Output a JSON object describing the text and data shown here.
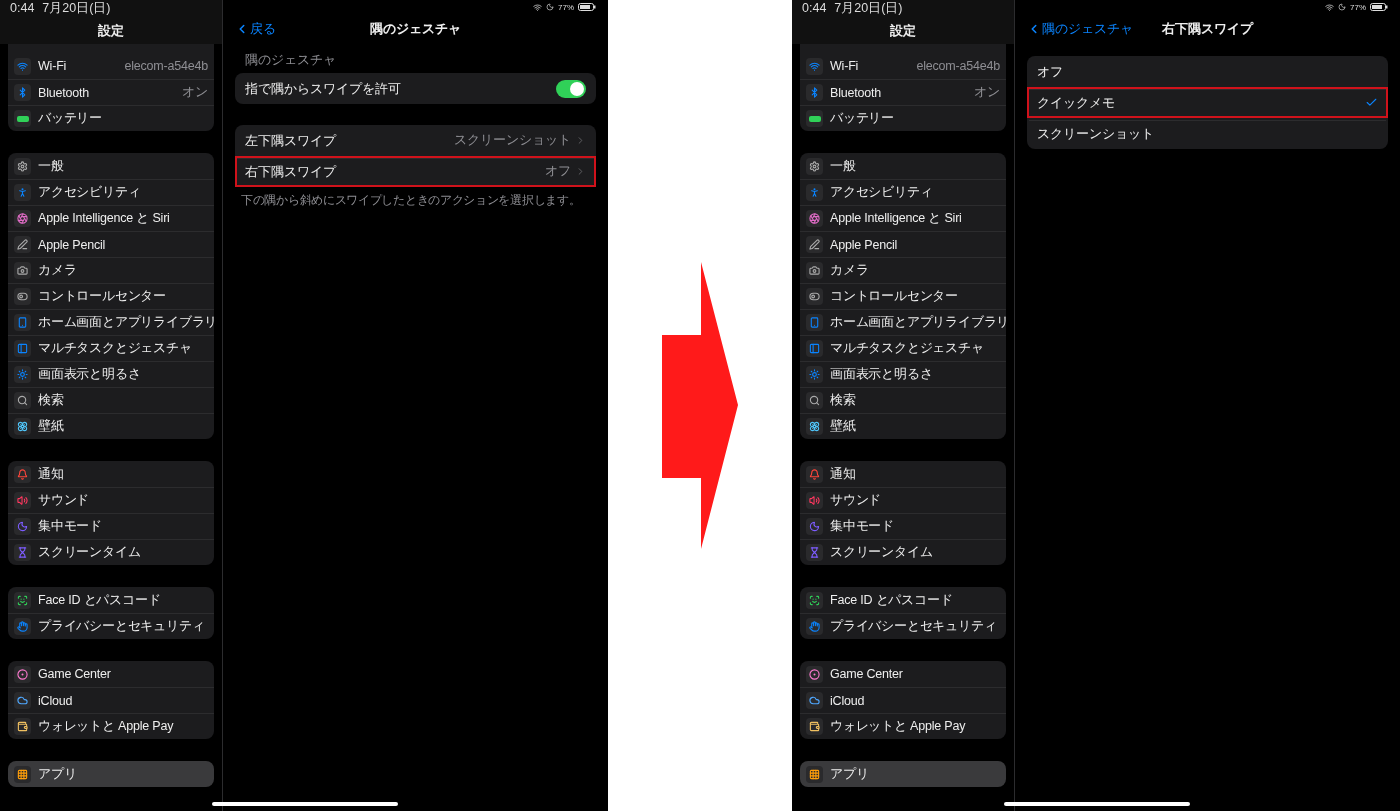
{
  "screens": [
    {
      "status": {
        "time": "0:44",
        "date": "7月20日(日)",
        "battery": "77%"
      },
      "sidebar": {
        "title": "設定",
        "groups": [
          {
            "items": [
              {
                "label": "Wi-Fi",
                "value": "elecom-a54e4b",
                "selected": false
              },
              {
                "label": "Bluetooth",
                "value": "オン",
                "selected": false
              },
              {
                "label": "バッテリー",
                "selected": false
              }
            ]
          },
          {
            "items": [
              {
                "label": "一般",
                "selected": false
              },
              {
                "label": "アクセシビリティ",
                "selected": false
              },
              {
                "label": "Apple Intelligence と Siri",
                "selected": false
              },
              {
                "label": "Apple Pencil",
                "selected": false
              },
              {
                "label": "カメラ",
                "selected": false
              },
              {
                "label": "コントロールセンター",
                "selected": false
              },
              {
                "label": "ホーム画面とアプリライブラリ",
                "selected": false
              },
              {
                "label": "マルチタスクとジェスチャ",
                "selected": false
              },
              {
                "label": "画面表示と明るさ",
                "selected": false
              },
              {
                "label": "検索",
                "selected": false
              },
              {
                "label": "壁紙",
                "selected": false
              }
            ]
          },
          {
            "items": [
              {
                "label": "通知",
                "selected": false
              },
              {
                "label": "サウンド",
                "selected": false
              },
              {
                "label": "集中モード",
                "selected": false
              },
              {
                "label": "スクリーンタイム",
                "selected": false
              }
            ]
          },
          {
            "items": [
              {
                "label": "Face ID とパスコード",
                "selected": false
              },
              {
                "label": "プライバシーとセキュリティ",
                "selected": false
              }
            ]
          },
          {
            "items": [
              {
                "label": "Game Center",
                "selected": false
              },
              {
                "label": "iCloud",
                "selected": false
              },
              {
                "label": "ウォレットと Apple Pay",
                "selected": false
              }
            ]
          },
          {
            "items": [
              {
                "label": "アプリ",
                "selected": true
              }
            ]
          }
        ]
      },
      "detail": {
        "kind": "gesture",
        "back": "戻る",
        "title": "隅のジェスチャ",
        "section_header": "隅のジェスチャ",
        "toggle": {
          "label": "指で隅からスワイプを許可",
          "on": true
        },
        "rows": [
          {
            "label": "左下隅スワイプ",
            "value": "スクリーンショット",
            "highlighted": false
          },
          {
            "label": "右下隅スワイプ",
            "value": "オフ",
            "highlighted": true
          }
        ],
        "footer": "下の隅から斜めにスワイプしたときのアクションを選択します。"
      }
    },
    {
      "status": {
        "time": "0:44",
        "date": "7月20日(日)",
        "battery": "77%"
      },
      "sidebar": {
        "title": "設定",
        "groups": [
          {
            "items": [
              {
                "label": "Wi-Fi",
                "value": "elecom-a54e4b",
                "selected": false
              },
              {
                "label": "Bluetooth",
                "value": "オン",
                "selected": false
              },
              {
                "label": "バッテリー",
                "selected": false
              }
            ]
          },
          {
            "items": [
              {
                "label": "一般",
                "selected": false
              },
              {
                "label": "アクセシビリティ",
                "selected": false
              },
              {
                "label": "Apple Intelligence と Siri",
                "selected": false
              },
              {
                "label": "Apple Pencil",
                "selected": false
              },
              {
                "label": "カメラ",
                "selected": false
              },
              {
                "label": "コントロールセンター",
                "selected": false
              },
              {
                "label": "ホーム画面とアプリライブラリ",
                "selected": false
              },
              {
                "label": "マルチタスクとジェスチャ",
                "selected": false
              },
              {
                "label": "画面表示と明るさ",
                "selected": false
              },
              {
                "label": "検索",
                "selected": false
              },
              {
                "label": "壁紙",
                "selected": false
              }
            ]
          },
          {
            "items": [
              {
                "label": "通知",
                "selected": false
              },
              {
                "label": "サウンド",
                "selected": false
              },
              {
                "label": "集中モード",
                "selected": false
              },
              {
                "label": "スクリーンタイム",
                "selected": false
              }
            ]
          },
          {
            "items": [
              {
                "label": "Face ID とパスコード",
                "selected": false
              },
              {
                "label": "プライバシーとセキュリティ",
                "selected": false
              }
            ]
          },
          {
            "items": [
              {
                "label": "Game Center",
                "selected": false
              },
              {
                "label": "iCloud",
                "selected": false
              },
              {
                "label": "ウォレットと Apple Pay",
                "selected": false
              }
            ]
          },
          {
            "items": [
              {
                "label": "アプリ",
                "selected": true
              }
            ]
          }
        ]
      },
      "detail": {
        "kind": "options",
        "back": "隅のジェスチャ",
        "title": "右下隅スワイプ",
        "options": [
          {
            "label": "オフ",
            "selected": false,
            "highlighted": false
          },
          {
            "label": "クイックメモ",
            "selected": true,
            "highlighted": true
          },
          {
            "label": "スクリーンショット",
            "selected": false,
            "highlighted": false
          }
        ]
      }
    }
  ]
}
